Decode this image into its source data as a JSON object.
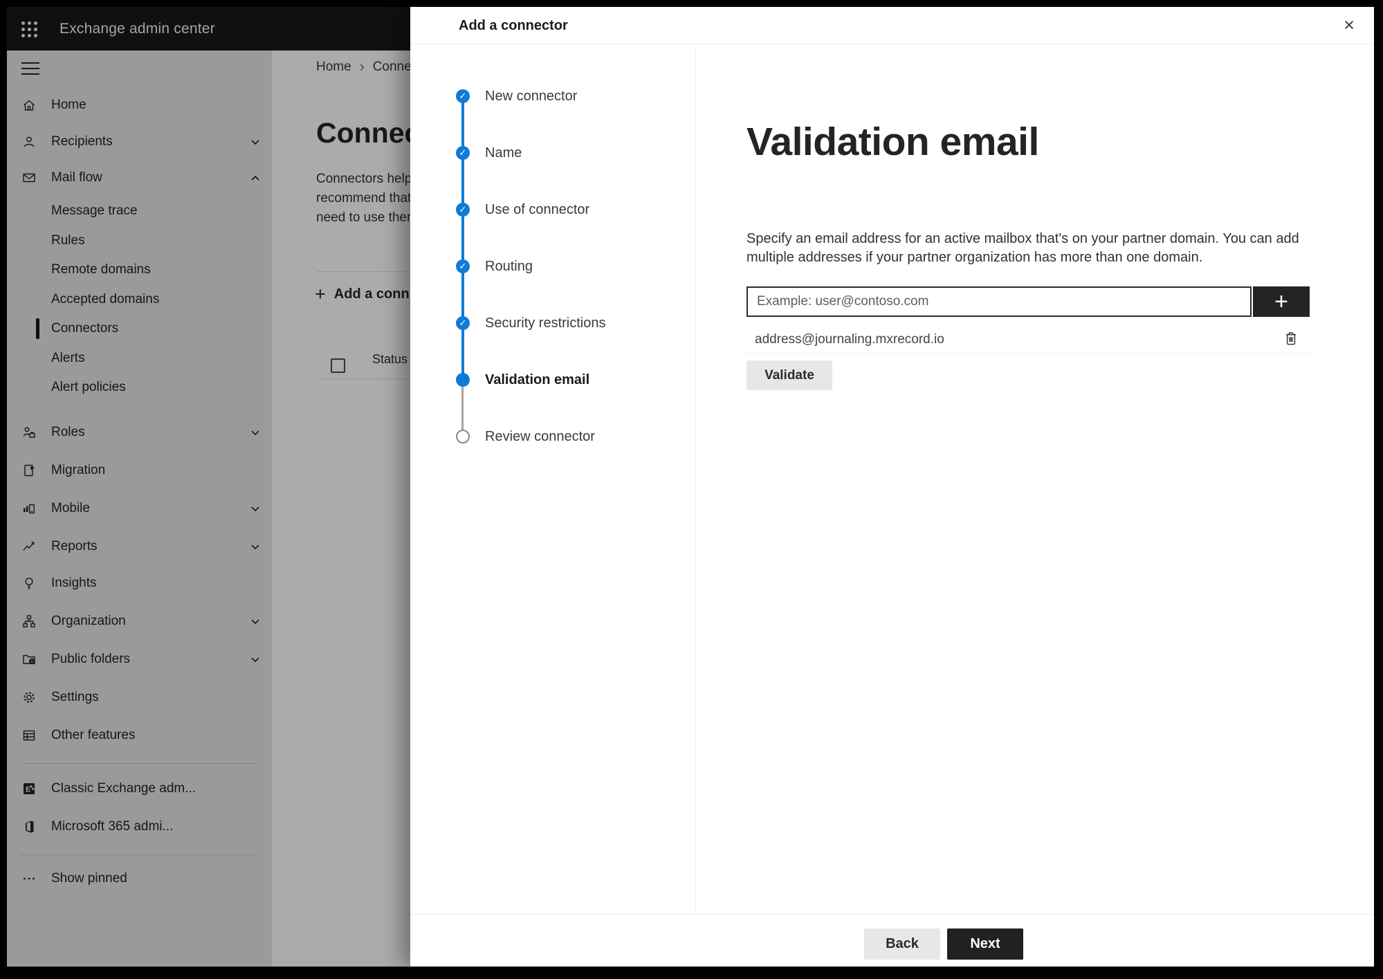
{
  "header": {
    "app_title": "Exchange admin center"
  },
  "sidebar": {
    "items": [
      {
        "label": "Home",
        "icon": "home-icon"
      },
      {
        "label": "Recipients",
        "icon": "people-icon",
        "chevron": "down"
      },
      {
        "label": "Mail flow",
        "icon": "mail-icon",
        "chevron": "up",
        "expanded": true
      },
      {
        "label": "Message trace",
        "sub": true
      },
      {
        "label": "Rules",
        "sub": true
      },
      {
        "label": "Remote domains",
        "sub": true
      },
      {
        "label": "Accepted domains",
        "sub": true
      },
      {
        "label": "Connectors",
        "sub": true,
        "selected": true
      },
      {
        "label": "Alerts",
        "sub": true
      },
      {
        "label": "Alert policies",
        "sub": true
      },
      {
        "label": "Roles",
        "icon": "roles-icon",
        "chevron": "down"
      },
      {
        "label": "Migration",
        "icon": "migration-icon"
      },
      {
        "label": "Mobile",
        "icon": "mobile-icon",
        "chevron": "down"
      },
      {
        "label": "Reports",
        "icon": "reports-icon",
        "chevron": "down"
      },
      {
        "label": "Insights",
        "icon": "insights-icon"
      },
      {
        "label": "Organization",
        "icon": "organization-icon",
        "chevron": "down"
      },
      {
        "label": "Public folders",
        "icon": "public-folders-icon",
        "chevron": "down"
      },
      {
        "label": "Settings",
        "icon": "settings-icon"
      },
      {
        "label": "Other features",
        "icon": "other-features-icon"
      },
      {
        "label": "Classic Exchange adm...",
        "icon": "classic-exchange-icon"
      },
      {
        "label": "Microsoft 365 admi...",
        "icon": "microsoft-365-icon"
      },
      {
        "label": "Show pinned",
        "icon": "more-icon"
      }
    ]
  },
  "page": {
    "breadcrumb": {
      "home": "Home",
      "separator": "›",
      "current": "Conne"
    },
    "title": "Connec",
    "description_lines": [
      "Connectors help",
      "recommend that",
      "need to use ther"
    ],
    "add_button": "Add a conn",
    "table": {
      "status_header": "Status"
    }
  },
  "wizard": {
    "title": "Add a connector",
    "steps": [
      {
        "label": "New connector",
        "state": "completed"
      },
      {
        "label": "Name",
        "state": "completed"
      },
      {
        "label": "Use of connector",
        "state": "completed"
      },
      {
        "label": "Routing",
        "state": "completed"
      },
      {
        "label": "Security restrictions",
        "state": "completed"
      },
      {
        "label": "Validation email",
        "state": "current"
      },
      {
        "label": "Review connector",
        "state": "upcoming"
      }
    ]
  },
  "content": {
    "heading": "Validation email",
    "description_lines": [
      "Specify an email address for an active mailbox that's on your partner domain. You can add",
      "multiple addresses if your partner organization has more than one domain."
    ],
    "email_input": {
      "value": "",
      "placeholder": "Example: user@contoso.com"
    },
    "addresses": [
      {
        "email": "address@journaling.mxrecord.io"
      }
    ],
    "validate_button": "Validate"
  },
  "footer": {
    "back_button": "Back",
    "next_button": "Next"
  },
  "icons": {
    "plus": "+",
    "close": "×",
    "check": "✓"
  },
  "colors": {
    "accent": "#0f7bd7",
    "dark_button": "#252423",
    "header_bg": "#1a1918"
  }
}
